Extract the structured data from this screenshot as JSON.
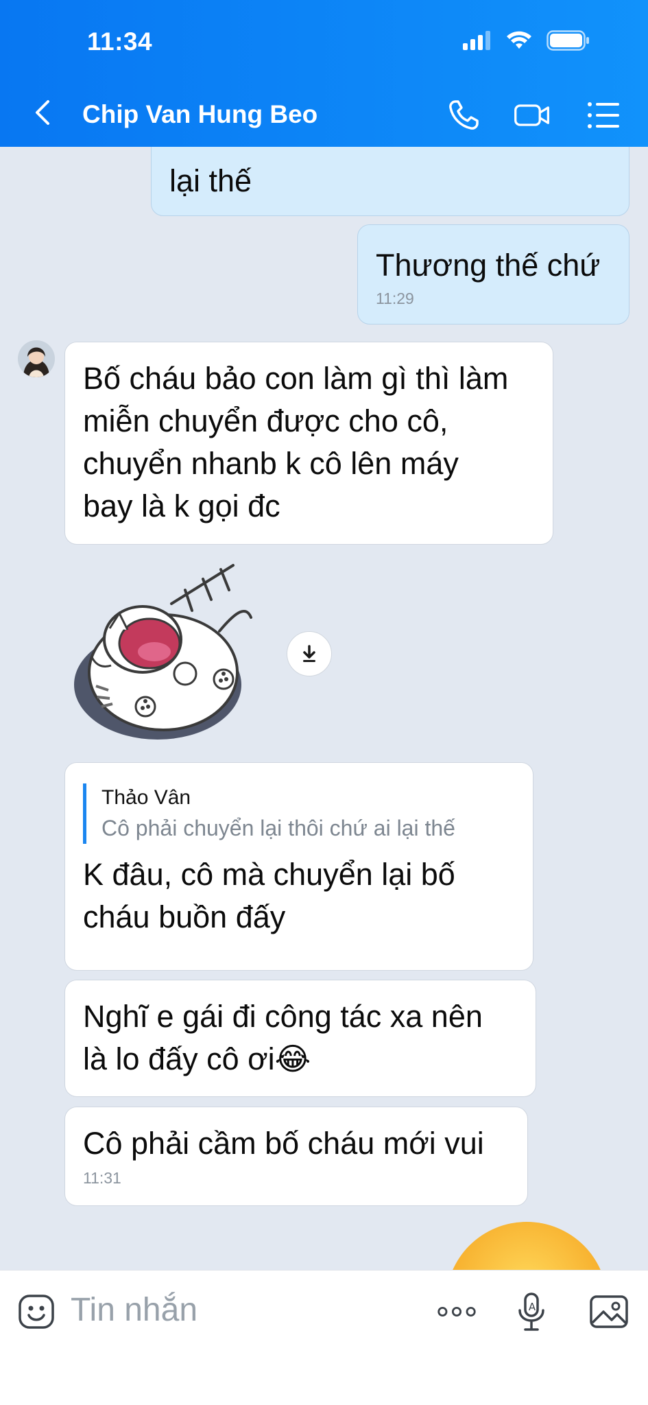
{
  "status_bar": {
    "time": "11:34"
  },
  "header": {
    "title": "Chip Van Hung Beo"
  },
  "messages": {
    "m1": {
      "line": "lại thế"
    },
    "m2": {
      "text": "Thương thế chứ",
      "time": "11:29"
    },
    "m3": {
      "lines": [
        "Bố cháu bảo con làm gì thì làm",
        "miễn chuyển được cho cô,",
        "chuyển nhanb k cô lên máy",
        "bay là k gọi đc"
      ]
    },
    "m4": {
      "quote_author": "Thảo Vân",
      "quote_text": "Cô phải chuyển lại thôi chứ ai lại thế",
      "lines": [
        "K đâu, cô mà chuyển lại bố",
        "cháu buồn đấy"
      ]
    },
    "m5": {
      "lines": [
        "Nghĩ e gái đi công tác xa nên",
        "là lo đấy cô ơi😂"
      ]
    },
    "m6": {
      "text": "Cô phải cầm bố cháu mới vui",
      "time": "11:31"
    }
  },
  "input": {
    "placeholder": "Tin nhắn"
  },
  "icons": {
    "back": "chevron-left-icon",
    "call": "phone-icon",
    "video": "video-camera-icon",
    "menu": "list-menu-icon",
    "download": "download-icon",
    "emoji": "emoji-icon",
    "more": "more-dots-icon",
    "voice": "microphone-icon",
    "image": "image-icon"
  },
  "colors": {
    "header": "#0b82f5",
    "my_bubble": "#d5ecfc",
    "background": "#e2e8f1"
  }
}
